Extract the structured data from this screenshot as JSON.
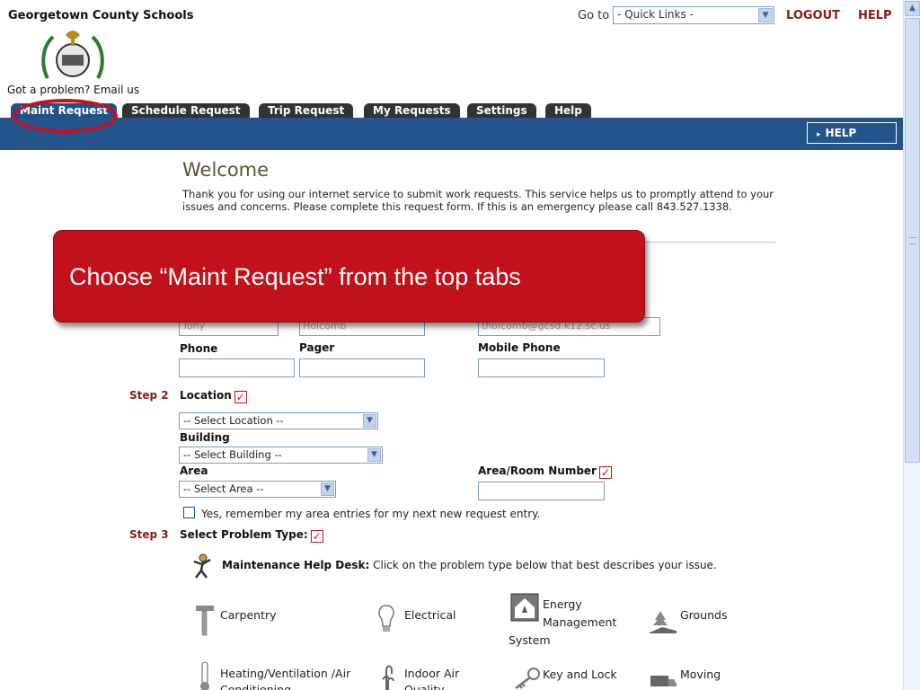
{
  "header": {
    "org_name": "Georgetown County Schools",
    "problem_link": "Got a problem? Email us",
    "goto_label": "Go to",
    "quick_links": "- Quick Links -",
    "logout": "LOGOUT",
    "help": "HELP"
  },
  "tabs": [
    {
      "label": "Maint Request",
      "active": true
    },
    {
      "label": "Schedule Request",
      "active": false
    },
    {
      "label": "Trip Request",
      "active": false
    },
    {
      "label": "My Requests",
      "active": false
    },
    {
      "label": "Settings",
      "active": false
    },
    {
      "label": "Help",
      "active": false
    }
  ],
  "bar_help": "HELP",
  "welcome": {
    "title": "Welcome",
    "text": "Thank you for using our internet service to submit work requests. This service helps us to promptly attend to your issues and concerns. Please complete this request form. If this is an emergency please call 843.527.1338."
  },
  "callout": "Choose “Maint Request” from the top tabs",
  "contact": {
    "first_name": "Tony",
    "last_name": "Holcomb",
    "email": "tholcomb@gcsd.k12.sc.us",
    "phone_label": "Phone",
    "pager_label": "Pager",
    "mobile_label": "Mobile Phone"
  },
  "step2": {
    "step": "Step 2",
    "location_label": "Location",
    "location_value": "-- Select Location --",
    "building_label": "Building",
    "building_value": "-- Select Building --",
    "area_label": "Area",
    "area_value": "-- Select Area --",
    "room_label": "Area/Room Number",
    "remember": "Yes, remember my area entries for my next new request entry."
  },
  "step3": {
    "step": "Step 3",
    "label": "Select Problem Type:",
    "helpdesk_title": "Maintenance Help Desk:",
    "helpdesk_text": "Click on the problem type below that best describes your issue."
  },
  "problem_types": {
    "carpentry": "Carpentry",
    "electrical": "Electrical",
    "energy_1": "Energy",
    "energy_2": "Management",
    "energy_3": "System",
    "grounds": "Grounds",
    "hvac_1": "Heating/Ventilation /Air",
    "hvac_2": "Conditioning",
    "iaq_1": "Indoor Air",
    "iaq_2": "Quality",
    "key_lock": "Key and Lock",
    "moving": "Moving"
  },
  "colors": {
    "nav_bar": "#23558c",
    "tab": "#333333",
    "accent_red": "#8b1a1a",
    "callout": "#c1121c"
  }
}
